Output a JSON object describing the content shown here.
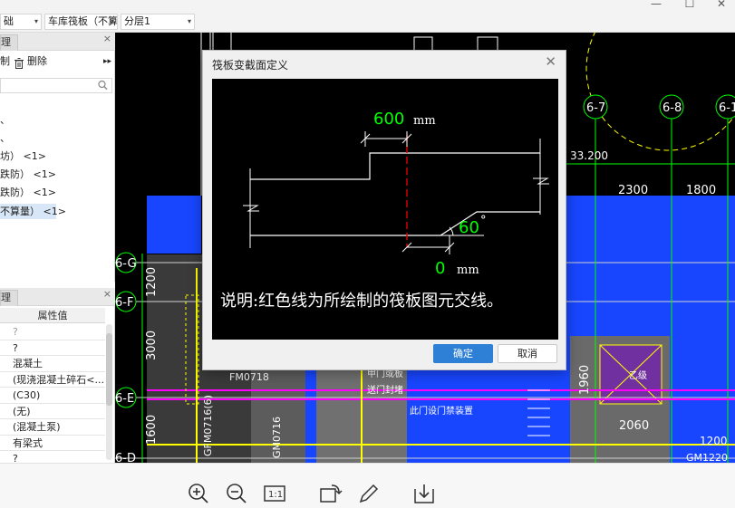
{
  "window": {
    "minimize": "—",
    "maximize": "☐",
    "close": "✕"
  },
  "toolbar": {
    "combo1": "础",
    "combo2": "车库筏板（不算",
    "combo3": "分层1"
  },
  "component_panel": {
    "tab_label": "理",
    "close": "×",
    "copy_label": "制",
    "delete_label": "删除",
    "more": "▸▸",
    "items": [
      "、",
      "、",
      "坊） <1>",
      "跌防） <1>",
      "跌防） <1>",
      "不算量） <1>"
    ]
  },
  "property_panel": {
    "tab_label": "理",
    "close": "×",
    "header": "属性值",
    "rows": [
      "?",
      "?",
      "混凝土",
      "(现浇混凝土碎石<...",
      "(C30)",
      "(无)",
      "(混凝土泵)",
      "有梁式",
      "?"
    ]
  },
  "cad": {
    "axis_labels": [
      "6-G",
      "6-F",
      "6-E",
      "6-D",
      "6-7",
      "6-8",
      "6-1"
    ],
    "dimensions": [
      "1200",
      "3000",
      "1600",
      "1960",
      "2300",
      "1800",
      "2060",
      "1200",
      "33.200",
      "GM1220"
    ],
    "texts": [
      "FM0718",
      "GFM0716(6)",
      "GM0716",
      "甲门或板",
      "送门封堵",
      "此门设门禁装置",
      "乙级"
    ]
  },
  "dialog": {
    "title": "筏板变截面定义",
    "close": "✕",
    "width_value": "600",
    "width_unit": "mm",
    "angle_value": "60",
    "angle_unit": "°",
    "offset_value": "0",
    "offset_unit": "mm",
    "note": "说明:红色线为所绘制的筏板图元交线。",
    "ok_label": "确定",
    "cancel_label": "取消"
  },
  "bottom_toolbar": [
    "zoom-in",
    "zoom-out",
    "actual-size",
    "rotate",
    "edit",
    "download"
  ]
}
